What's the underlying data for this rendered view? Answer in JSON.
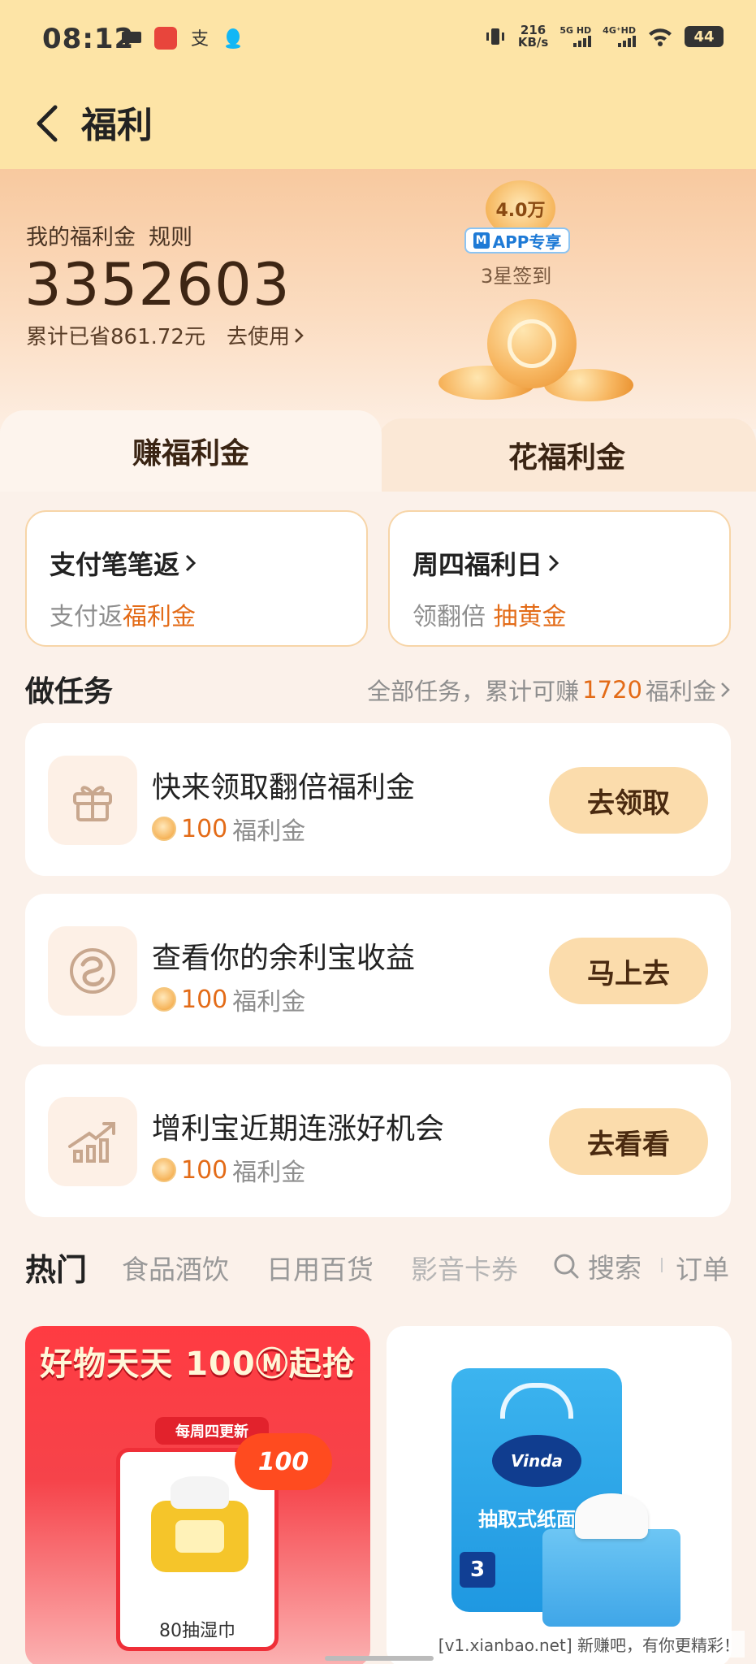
{
  "status_bar": {
    "time": "08:12",
    "net_speed_value": "216",
    "net_speed_unit": "KB/s",
    "sim1": "5G HD",
    "sim2": "4G⁺HD",
    "battery": "44"
  },
  "header": {
    "title": "福利"
  },
  "hero": {
    "label": "我的福利金",
    "rules": "规则",
    "balance": "3352603",
    "saved": "累计已省861.72元",
    "use_link": "去使用",
    "badge_amount": "4.0万",
    "badge_tag": "APP专享",
    "badge_caption": "3星签到"
  },
  "tabs": [
    {
      "label": "赚福利金",
      "active": true
    },
    {
      "label": "花福利金",
      "active": false
    }
  ],
  "promos": [
    {
      "title": "支付笔笔返",
      "sub_plain": "支付返",
      "sub_highlight": "福利金"
    },
    {
      "title": "周四福利日",
      "sub_plain": "领翻倍 ",
      "sub_highlight": "抽黄金"
    }
  ],
  "tasks_section": {
    "title": "做任务",
    "link_prefix": "全部任务，累计可赚",
    "link_number": "1720",
    "link_suffix": "福利金"
  },
  "tasks": [
    {
      "title": "快来领取翻倍福利金",
      "amount": "100",
      "unit": "福利金",
      "button": "去领取",
      "icon": "gift-icon"
    },
    {
      "title": "查看你的余利宝收益",
      "amount": "100",
      "unit": "福利金",
      "button": "马上去",
      "icon": "yulibao-icon"
    },
    {
      "title": "增利宝近期连涨好机会",
      "amount": "100",
      "unit": "福利金",
      "button": "去看看",
      "icon": "trend-up-icon"
    }
  ],
  "categories": {
    "items": [
      "热门",
      "食品酒饮",
      "日用百货",
      "影音卡券"
    ],
    "search": "搜索",
    "orders": "订单"
  },
  "products": {
    "left": {
      "banner": "好物天天 100Ⓜ起抢",
      "weekly_tag": "每周四更新",
      "burst": "100",
      "caption": "80抽湿巾"
    },
    "right": {
      "brand": "Vinda",
      "name": "抽取式纸面巾",
      "pack": "3"
    }
  },
  "watermark": "[v1.xianbao.net] 新赚吧，有你更精彩！",
  "colors": {
    "accent": "#e36b17",
    "header_bg": "#fde4a6",
    "button_bg": "#fbdcac"
  }
}
